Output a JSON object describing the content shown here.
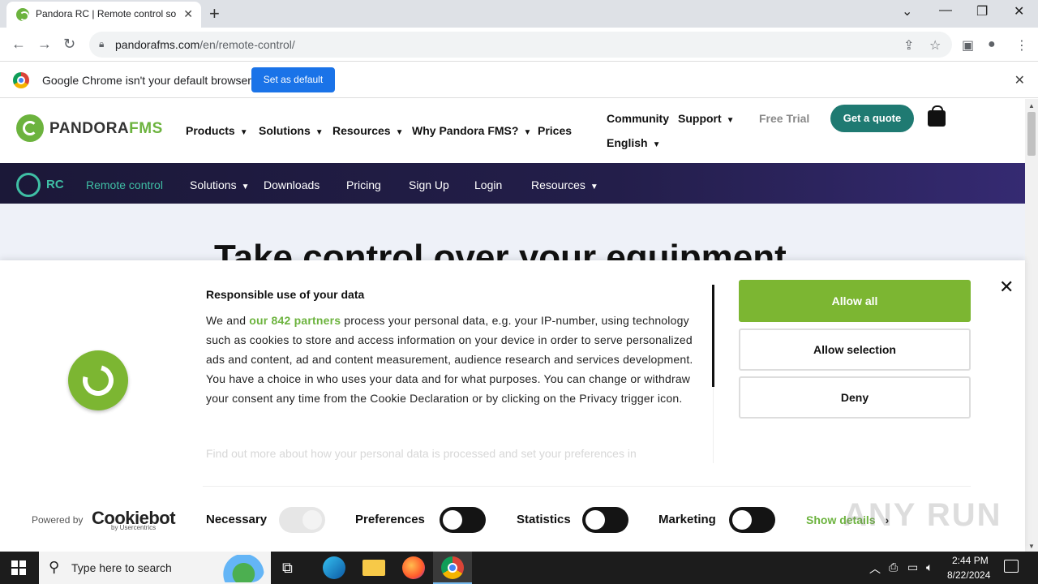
{
  "browser": {
    "tab_title": "Pandora RC | Remote control so",
    "url_domain": "pandorafms.com",
    "url_path": "/en/remote-control/",
    "infobar_message": "Google Chrome isn't your default browser",
    "set_default_label": "Set as default"
  },
  "site": {
    "logo_text_a": "PANDORA",
    "logo_text_b": "FMS",
    "main_nav": [
      "Products",
      "Solutions",
      "Resources",
      "Why Pandora FMS?",
      "Prices"
    ],
    "top_nav": {
      "community": "Community",
      "support": "Support",
      "language": "English",
      "free_trial": "Free Trial",
      "get_quote": "Get a quote"
    }
  },
  "rc_bar": {
    "brand": "RC",
    "items": [
      "Remote control",
      "Solutions",
      "Downloads",
      "Pricing",
      "Sign Up",
      "Login",
      "Resources"
    ]
  },
  "hero": {
    "title": "Take control over your equipment"
  },
  "cookie": {
    "title": "Responsible use of your data",
    "body_pre": "We and ",
    "partners_link": "our 842 partners",
    "body_post": " process your personal data, e.g. your IP-number, using technology such as cookies to store and access information on your device in order to serve personalized ads and content, ad and content measurement, audience research and services development. You have a choice in who uses your data and for what purposes. You can change or withdraw your consent any time from the Cookie Declaration or by clicking on the Privacy trigger icon.",
    "faded_text": "Find out more about how your personal data is processed and set your preferences in",
    "allow_all": "Allow all",
    "allow_selection": "Allow selection",
    "deny": "Deny",
    "powered_by": "Powered by",
    "cookiebot": "Cookiebot",
    "cookiebot_sub": "by Usercentrics",
    "toggles": [
      {
        "label": "Necessary",
        "state": "on-disabled"
      },
      {
        "label": "Preferences",
        "state": "off"
      },
      {
        "label": "Statistics",
        "state": "off"
      },
      {
        "label": "Marketing",
        "state": "off"
      }
    ],
    "show_details": "Show details"
  },
  "watermark": "ANY RUN",
  "taskbar": {
    "search_placeholder": "Type here to search",
    "time": "2:44 PM",
    "date": "8/22/2024"
  },
  "colors": {
    "brand_green": "#6cb33e",
    "accept_green": "#7cb632",
    "teal": "#1f7a72",
    "rc_bar": "#1b1838"
  }
}
